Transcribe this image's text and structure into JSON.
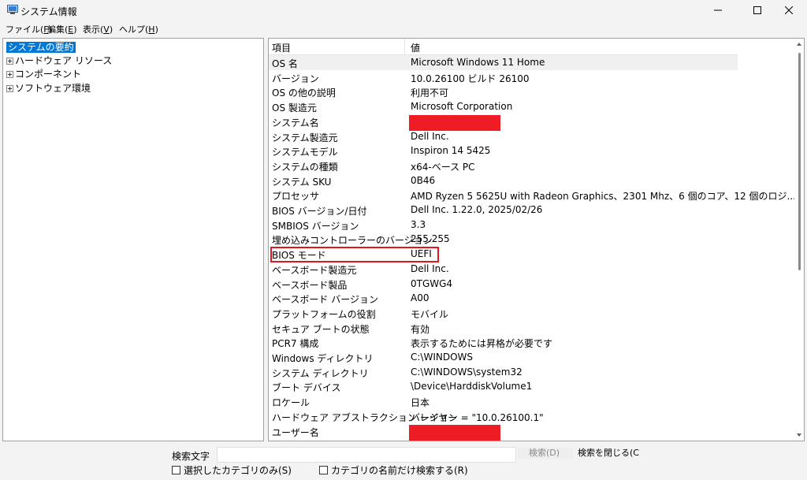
{
  "window": {
    "title": "システム情報"
  },
  "menu": [
    {
      "label": "ファイル(",
      "key": "F",
      "end": ")"
    },
    {
      "label": "編集(",
      "key": "E",
      "end": ")"
    },
    {
      "label": "表示(",
      "key": "V",
      "end": ")"
    },
    {
      "label": "ヘルプ(",
      "key": "H",
      "end": ")"
    }
  ],
  "tree": [
    {
      "label": "システムの要約",
      "selected": true,
      "expandable": false
    },
    {
      "label": "ハードウェア リソース",
      "selected": false,
      "expandable": true
    },
    {
      "label": "コンポーネント",
      "selected": false,
      "expandable": true
    },
    {
      "label": "ソフトウェア環境",
      "selected": false,
      "expandable": true
    }
  ],
  "table": {
    "headers": [
      "項目",
      "値"
    ],
    "rows": [
      [
        "OS 名",
        "Microsoft Windows 11 Home"
      ],
      [
        "バージョン",
        "10.0.26100 ビルド 26100"
      ],
      [
        "OS の他の説明",
        "利用不可"
      ],
      [
        "OS 製造元",
        "Microsoft Corporation"
      ],
      [
        "システム名",
        ""
      ],
      [
        "システム製造元",
        "Dell Inc."
      ],
      [
        "システムモデル",
        "Inspiron 14 5425"
      ],
      [
        "システムの種類",
        "x64-ベース PC"
      ],
      [
        "システム SKU",
        "0B46"
      ],
      [
        "プロセッサ",
        "AMD Ryzen 5 5625U with Radeon Graphics、2301 Mhz、6 個のコア、12 個のロジ..."
      ],
      [
        "BIOS バージョン/日付",
        "Dell Inc. 1.22.0, 2025/02/26"
      ],
      [
        "SMBIOS バージョン",
        "3.3"
      ],
      [
        "埋め込みコントローラーのバージョン",
        "255.255"
      ],
      [
        "BIOS モード",
        "UEFI"
      ],
      [
        "ベースボード製造元",
        "Dell Inc."
      ],
      [
        "ベースボード製品",
        "0TGWG4"
      ],
      [
        "ベースボード バージョン",
        "A00"
      ],
      [
        "プラットフォームの役割",
        "モバイル"
      ],
      [
        "セキュア ブートの状態",
        "有効"
      ],
      [
        "PCR7 構成",
        "表示するためには昇格が必要です"
      ],
      [
        "Windows ディレクトリ",
        "C:\\WINDOWS"
      ],
      [
        "システム ディレクトリ",
        "C:\\WINDOWS\\system32"
      ],
      [
        "ブート デバイス",
        "\\Device\\HarddiskVolume1"
      ],
      [
        "ロケール",
        "日本"
      ],
      [
        "ハードウェア アブストラクション レイヤー",
        "バージョン = \"10.0.26100.1\""
      ],
      [
        "ユーザー名",
        ""
      ]
    ],
    "redacted_rows": [
      4,
      25
    ],
    "highlight_row": 13
  },
  "search": {
    "label": "検索文字",
    "value": "",
    "search_button": "検索(D)",
    "close_button": "検索を閉じる(C",
    "option1": "選択したカテゴリのみ(S)",
    "option2": "カテゴリの名前だけ検索する(R)"
  },
  "colors": {
    "selection": "#0078d7",
    "redaction": "#ee1c25",
    "highlight": "#e0151d"
  }
}
